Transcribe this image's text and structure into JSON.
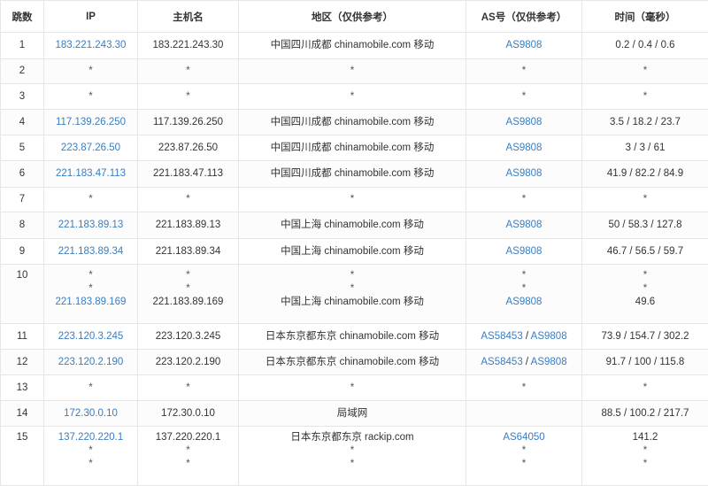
{
  "headers": [
    "跳数",
    "IP",
    "主机名",
    "地区（仅供参考）",
    "AS号（仅供参考）",
    "时间（毫秒）"
  ],
  "rows": [
    {
      "hop": "1",
      "ip": [
        "183.221.243.30"
      ],
      "host": [
        "183.221.243.30"
      ],
      "region": [
        "中国四川成都 chinamobile.com 移动"
      ],
      "as": [
        [
          "AS9808"
        ]
      ],
      "time": [
        "0.2 / 0.4 / 0.6"
      ]
    },
    {
      "hop": "2",
      "ip": [
        "*"
      ],
      "host": [
        "*"
      ],
      "region": [
        "*"
      ],
      "as": [
        [
          "*"
        ]
      ],
      "time": [
        "*"
      ]
    },
    {
      "hop": "3",
      "ip": [
        "*"
      ],
      "host": [
        "*"
      ],
      "region": [
        "*"
      ],
      "as": [
        [
          "*"
        ]
      ],
      "time": [
        "*"
      ]
    },
    {
      "hop": "4",
      "ip": [
        "117.139.26.250"
      ],
      "host": [
        "117.139.26.250"
      ],
      "region": [
        "中国四川成都 chinamobile.com 移动"
      ],
      "as": [
        [
          "AS9808"
        ]
      ],
      "time": [
        "3.5 / 18.2 / 23.7"
      ]
    },
    {
      "hop": "5",
      "ip": [
        "223.87.26.50"
      ],
      "host": [
        "223.87.26.50"
      ],
      "region": [
        "中国四川成都 chinamobile.com 移动"
      ],
      "as": [
        [
          "AS9808"
        ]
      ],
      "time": [
        "3 / 3 / 61"
      ]
    },
    {
      "hop": "6",
      "ip": [
        "221.183.47.113"
      ],
      "host": [
        "221.183.47.113"
      ],
      "region": [
        "中国四川成都 chinamobile.com 移动"
      ],
      "as": [
        [
          "AS9808"
        ]
      ],
      "time": [
        "41.9 / 82.2 / 84.9"
      ]
    },
    {
      "hop": "7",
      "ip": [
        "*"
      ],
      "host": [
        "*"
      ],
      "region": [
        "*"
      ],
      "as": [
        [
          "*"
        ]
      ],
      "time": [
        "*"
      ]
    },
    {
      "hop": "8",
      "ip": [
        "221.183.89.13"
      ],
      "host": [
        "221.183.89.13"
      ],
      "region": [
        "中国上海 chinamobile.com 移动"
      ],
      "as": [
        [
          "AS9808"
        ]
      ],
      "time": [
        "50 / 58.3 / 127.8"
      ]
    },
    {
      "hop": "9",
      "ip": [
        "221.183.89.34"
      ],
      "host": [
        "221.183.89.34"
      ],
      "region": [
        "中国上海 chinamobile.com 移动"
      ],
      "as": [
        [
          "AS9808"
        ]
      ],
      "time": [
        "46.7 / 56.5 / 59.7"
      ]
    },
    {
      "hop": "10",
      "ip": [
        "*",
        "*",
        "221.183.89.169"
      ],
      "host": [
        "*",
        "*",
        "221.183.89.169"
      ],
      "region": [
        "*",
        "*",
        "中国上海 chinamobile.com 移动"
      ],
      "as": [
        [
          "*"
        ],
        [
          "*"
        ],
        [
          "AS9808"
        ]
      ],
      "time": [
        "*",
        "*",
        "49.6"
      ]
    },
    {
      "hop": "11",
      "ip": [
        "223.120.3.245"
      ],
      "host": [
        "223.120.3.245"
      ],
      "region": [
        "日本东京都东京 chinamobile.com 移动"
      ],
      "as": [
        [
          "AS58453",
          "AS9808"
        ]
      ],
      "time": [
        "73.9 / 154.7 / 302.2"
      ]
    },
    {
      "hop": "12",
      "ip": [
        "223.120.2.190"
      ],
      "host": [
        "223.120.2.190"
      ],
      "region": [
        "日本东京都东京 chinamobile.com 移动"
      ],
      "as": [
        [
          "AS58453",
          "AS9808"
        ]
      ],
      "time": [
        "91.7 / 100 / 115.8"
      ]
    },
    {
      "hop": "13",
      "ip": [
        "*"
      ],
      "host": [
        "*"
      ],
      "region": [
        "*"
      ],
      "as": [
        [
          "*"
        ]
      ],
      "time": [
        "*"
      ]
    },
    {
      "hop": "14",
      "ip": [
        "172.30.0.10"
      ],
      "host": [
        "172.30.0.10"
      ],
      "region": [
        "局域网"
      ],
      "as": [
        []
      ],
      "time": [
        "88.5 / 100.2 / 217.7"
      ]
    },
    {
      "hop": "15",
      "ip": [
        "137.220.220.1",
        "*",
        "*"
      ],
      "host": [
        "137.220.220.1",
        "*",
        "*"
      ],
      "region": [
        "日本东京都东京 rackip.com",
        "*",
        "*"
      ],
      "as": [
        [
          "AS64050"
        ],
        [
          "*"
        ],
        [
          "*"
        ]
      ],
      "time": [
        "141.2",
        "*",
        "*"
      ]
    }
  ],
  "as_separator": " / ",
  "colors": {
    "link": "#3a7dbf",
    "border": "#e6e6e6",
    "text": "#333333"
  }
}
